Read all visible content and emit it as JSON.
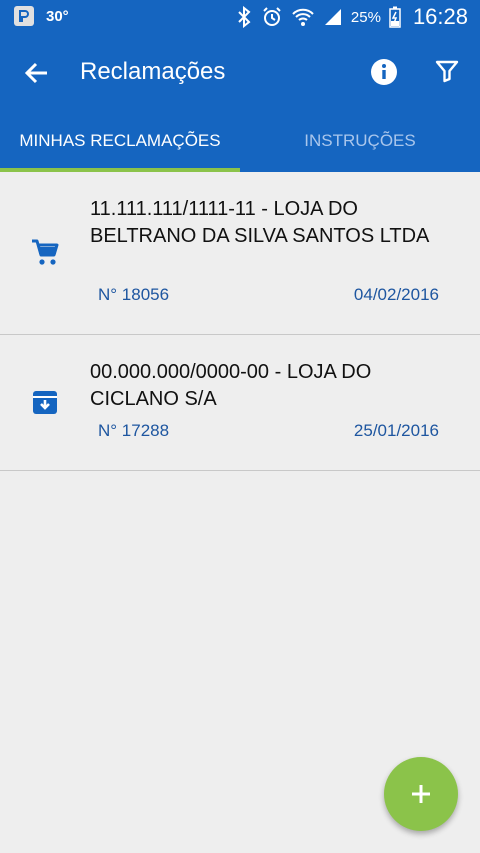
{
  "status_bar": {
    "temperature": "30°",
    "battery": "25%",
    "time": "16:28"
  },
  "app_bar": {
    "title": "Reclamações"
  },
  "tabs": [
    {
      "label": "MINHAS RECLAMAÇÕES",
      "active": true
    },
    {
      "label": "INSTRUÇÕES",
      "active": false
    }
  ],
  "complaints": [
    {
      "icon": "shopping-cart-icon",
      "company": "11.111.111/1111-11 - LOJA DO BELTRANO DA SILVA SANTOS LTDA",
      "number": "N° 18056",
      "date": "04/02/2016"
    },
    {
      "icon": "archive-box-icon",
      "company": "00.000.000/0000-00 - LOJA DO CICLANO S/A",
      "number": "N° 17288",
      "date": "25/01/2016"
    }
  ],
  "colors": {
    "primary": "#1565c0",
    "accent": "#8bc34a",
    "link_text": "#1e56a0",
    "background": "#eeeeee"
  }
}
